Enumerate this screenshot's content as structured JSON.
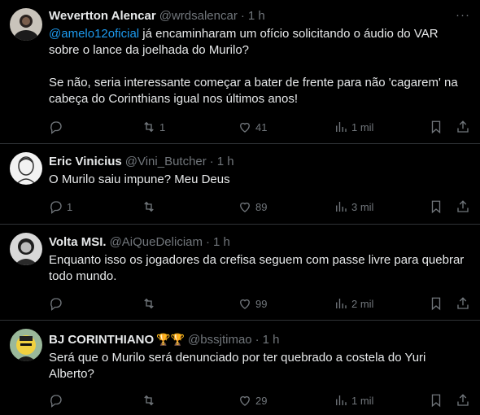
{
  "tweets": [
    {
      "name": "Wevertton Alencar",
      "handle": "@wrdsalencar",
      "time": "1 h",
      "mention": "@amelo12oficial",
      "text_after_mention": " já encaminharam um ofício solicitando o áudio do VAR sobre o lance da joelhada do Murilo?\n\nSe não, seria interessante começar a bater de frente para não 'cagarem' na cabeça do Corinthians igual nos últimos anos!",
      "replies": "",
      "retweets": "1",
      "likes": "41",
      "views": "1 mil"
    },
    {
      "name": "Eric Vinicius",
      "handle": "@Vini_Butcher",
      "time": "1 h",
      "text": "O Murilo saiu impune? Meu Deus",
      "replies": "1",
      "retweets": "",
      "likes": "89",
      "views": "3 mil"
    },
    {
      "name": "Volta MSI.",
      "handle": "@AiQueDeliciam",
      "time": "1 h",
      "text": "Enquanto isso os jogadores da crefisa seguem com passe livre para quebrar todo mundo.",
      "replies": "",
      "retweets": "",
      "likes": "99",
      "views": "2 mil"
    },
    {
      "name": "BJ CORINTHIANO",
      "name_emoji": "🏆🏆",
      "handle": "@bssjtimao",
      "time": "1 h",
      "text": "Será que o Murilo será denunciado por ter quebrado a costela do Yuri Alberto?",
      "replies": "",
      "retweets": "",
      "likes": "29",
      "views": "1 mil"
    }
  ],
  "ui": {
    "separator": "·",
    "more": "···"
  },
  "colors": {
    "background": "#000000",
    "text": "#e7e9ea",
    "muted": "#71767b",
    "link": "#1d9bf0",
    "border": "#2f3336"
  },
  "icons": [
    "reply-icon",
    "retweet-icon",
    "like-icon",
    "views-icon",
    "bookmark-icon",
    "share-icon",
    "more-icon"
  ]
}
